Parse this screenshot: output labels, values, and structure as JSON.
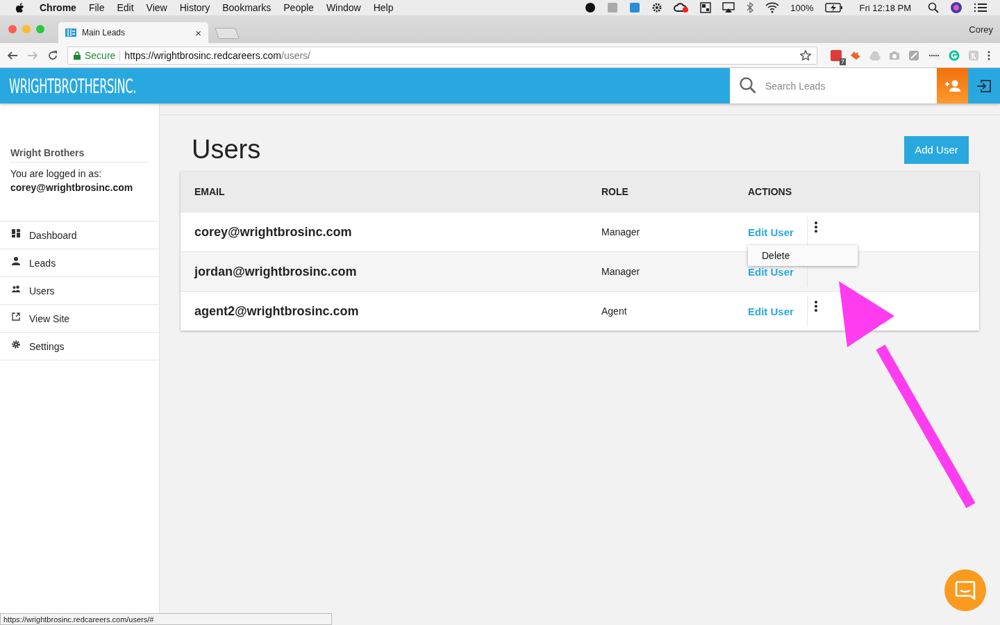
{
  "menu_bar": {
    "app": "Chrome",
    "items": [
      "File",
      "Edit",
      "View",
      "History",
      "Bookmarks",
      "People",
      "Window",
      "Help"
    ],
    "battery": "100%",
    "clock": "Fri 12:18 PM"
  },
  "browser": {
    "tab": {
      "title": "Main Leads",
      "close": "×"
    },
    "profile": "Corey",
    "secure_label": "Secure",
    "url_host": "https://wrightbrosinc.redcareers.com",
    "url_path": "/users/",
    "extension_badge": "7"
  },
  "header": {
    "logo": "WRIGHTBROTHERSINC.",
    "search": {
      "placeholder": "Search Leads"
    }
  },
  "sidebar": {
    "company": "Wright Brothers",
    "login_label": "You are logged in as:",
    "login_email": "corey@wrightbrosinc.com",
    "items": [
      {
        "label": "Dashboard",
        "kind": "dashboard"
      },
      {
        "label": "Leads",
        "kind": "person"
      },
      {
        "label": "Users",
        "kind": "people"
      },
      {
        "label": "View Site",
        "kind": "external"
      },
      {
        "label": "Settings",
        "kind": "gear"
      }
    ]
  },
  "page": {
    "title": "Users",
    "add_button": "Add User"
  },
  "table": {
    "columns": [
      "EMAIL",
      "ROLE",
      "ACTIONS"
    ],
    "rows": [
      {
        "email": "corey@wrightbrosinc.com",
        "role": "Manager",
        "action": "Edit User",
        "menu_open": true
      },
      {
        "email": "jordan@wrightbrosinc.com",
        "role": "Manager",
        "action": "Edit User",
        "menu_open": false
      },
      {
        "email": "agent2@wrightbrosinc.com",
        "role": "Agent",
        "action": "Edit User",
        "menu_open": false
      }
    ]
  },
  "row_menu": {
    "items": [
      "Delete"
    ]
  },
  "status_url": "https://wrightbrosinc.redcareers.com/users/#"
}
